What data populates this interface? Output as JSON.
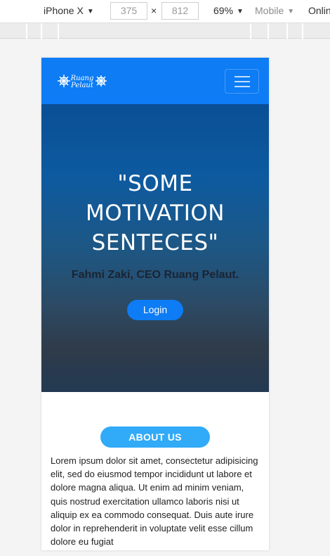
{
  "devtools": {
    "device": "iPhone X",
    "width": "375",
    "height": "812",
    "times": "×",
    "zoom": "69%",
    "throttle": "Mobile",
    "network": "Onlin",
    "caret": "▼"
  },
  "navbar": {
    "logo_text_top": "Ruang",
    "logo_text_bottom": "Pelaut",
    "brand_color": "#0d7cf5"
  },
  "hero": {
    "title_line1": "\"SOME",
    "title_line2": "MOTIVATION",
    "title_line3": "SENTECES\"",
    "subtitle": "Fahmi Zaki, CEO Ruang Pelaut.",
    "login_label": "Login"
  },
  "about": {
    "button_label": "ABOUT US",
    "text": "Lorem ipsum dolor sit amet, consectetur adipisicing elit, sed do eiusmod tempor incididunt ut labore et dolore magna aliqua. Ut enim ad minim veniam, quis nostrud exercitation ullamco laboris nisi ut aliquip ex ea commodo consequat. Duis aute irure dolor in reprehenderit in voluptate velit esse cillum dolore eu fugiat",
    "accent_color": "#31aaf8"
  }
}
